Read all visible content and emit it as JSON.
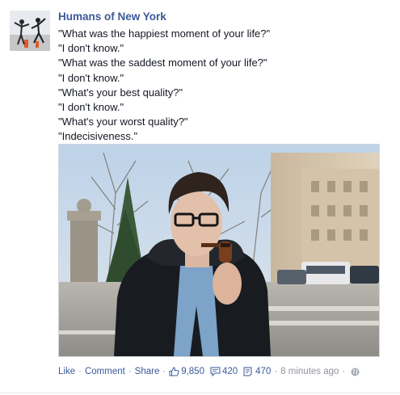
{
  "post": {
    "page_name": "Humans of New York",
    "caption_lines": [
      "\"What was the happiest moment of your life?\"",
      "\"I don't know.\"",
      "\"What was the saddest moment of your life?\"",
      "\"I don't know.\"",
      "\"What's your best quality?\"",
      "\"I don't know.\"",
      "\"What's your worst quality?\"",
      "\"Indecisiveness.\""
    ]
  },
  "actions": {
    "like": "Like",
    "comment": "Comment",
    "share": "Share",
    "separator": "·",
    "likes_count": "9,850",
    "comments_count": "420",
    "shares_count": "470",
    "timestamp": "8 minutes ago",
    "icons": {
      "likes": "thumbs-up-icon",
      "comments": "comment-bubble-icon",
      "shares": "share-icon",
      "audience": "globe-icon"
    }
  },
  "colors": {
    "link": "#3b5998",
    "meta": "#90949c",
    "text": "#141823"
  }
}
